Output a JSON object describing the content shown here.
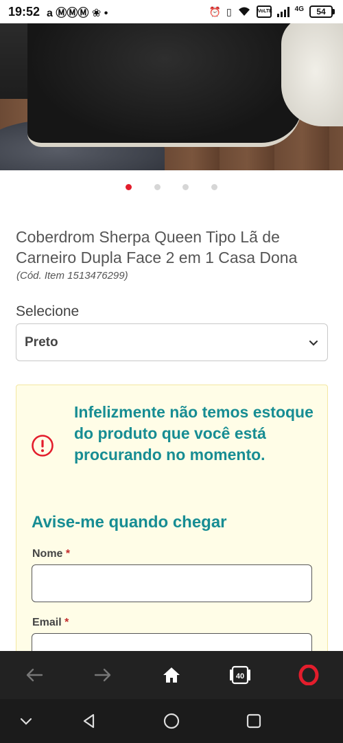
{
  "status_bar": {
    "time": "19:52",
    "notification_icons": "a ⓂⓂⓂ ❀ •",
    "network_badges": [
      "VoLTE",
      "4G"
    ],
    "battery_level": "54"
  },
  "product": {
    "image_alt": "Coberdrom Sherpa",
    "carousel": {
      "total": 4,
      "active_index": 0,
      "active_color": "#e31d2c"
    },
    "title": "Coberdrom Sherpa Queen Tipo Lã de Carneiro Dupla Face 2 em 1 Casa Dona",
    "sku": "(Cód. Item 1513476299)"
  },
  "variant_select": {
    "label": "Selecione",
    "selected_value": "Preto"
  },
  "stock_alert": {
    "message": "Infelizmente não temos estoque do produto que você está procurando no momento.",
    "notify_title": "Avise-me quando chegar",
    "fields": [
      {
        "label": "Nome",
        "required_mark": "*",
        "value": ""
      },
      {
        "label": "Email",
        "required_mark": "*",
        "value": ""
      }
    ],
    "accent_color": "#178d93",
    "icon_color": "#e31d2c"
  },
  "browser_toolbar": {
    "tab_count": "40",
    "icons": [
      "back-arrow-icon",
      "forward-arrow-icon",
      "home-icon",
      "tabs-icon",
      "opera-logo-icon"
    ]
  },
  "system_nav": {
    "icons": [
      "collapse-chevron-icon",
      "back-triangle-icon",
      "home-circle-icon",
      "recents-square-icon"
    ]
  }
}
